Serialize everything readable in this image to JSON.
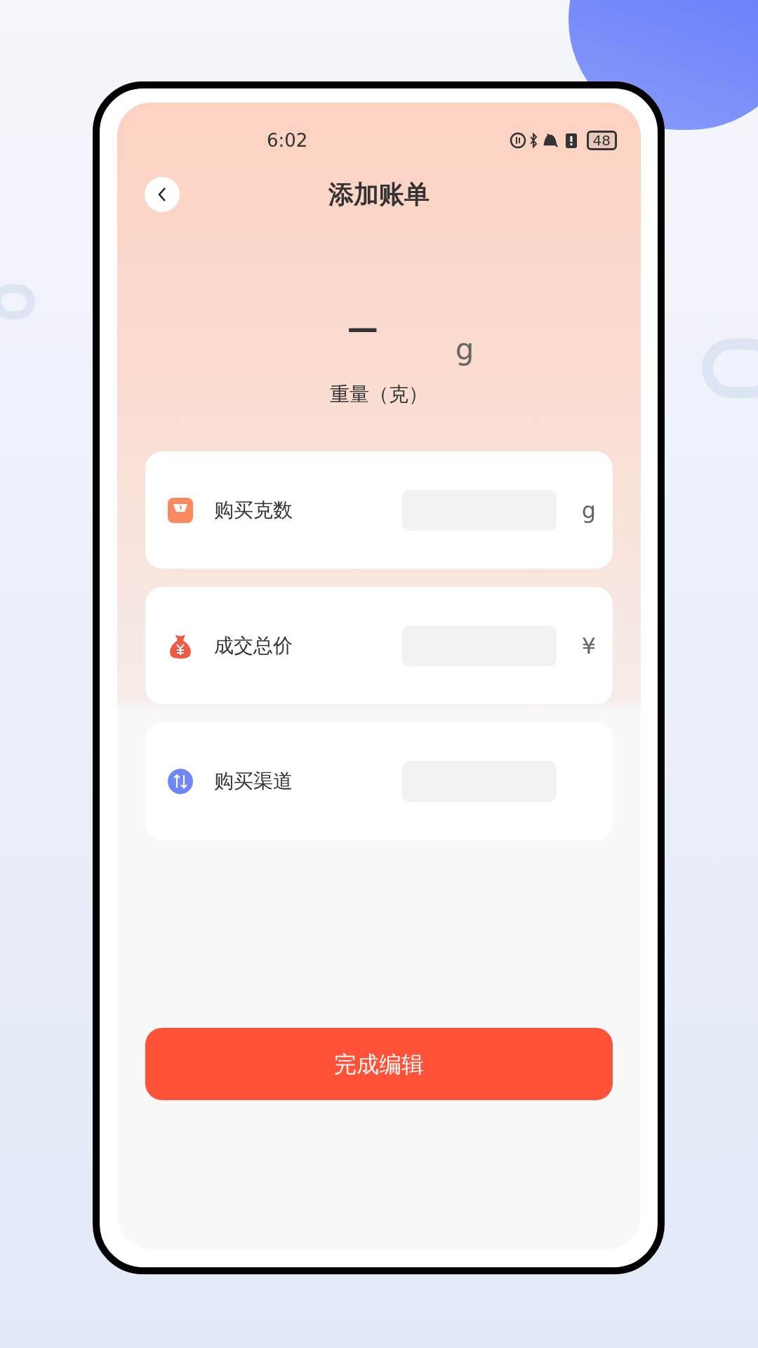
{
  "status_bar": {
    "time": "6:02",
    "battery": "48"
  },
  "header": {
    "title": "添加账单"
  },
  "weight_display": {
    "value": "—",
    "unit": "g",
    "label": "重量（克）"
  },
  "fields": [
    {
      "kind": "weight",
      "label": "购买克数",
      "unit": "g"
    },
    {
      "kind": "price",
      "label": "成交总价",
      "unit": "¥"
    },
    {
      "kind": "channel",
      "label": "购买渠道"
    }
  ],
  "submit_button": {
    "label": "完成编辑"
  }
}
